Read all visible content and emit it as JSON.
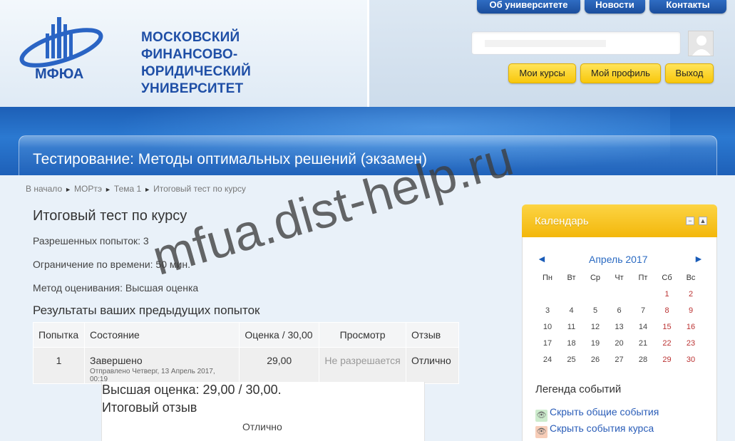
{
  "header": {
    "logo_text": "МФЮА",
    "university_name_lines": [
      "МОСКОВСКИЙ",
      "ФИНАНСОВО-",
      "ЮРИДИЧЕСКИЙ",
      "УНИВЕРСИТЕТ"
    ],
    "top_nav": [
      "Об университете",
      "Новости",
      "Контакты"
    ],
    "user_buttons": [
      "Мои курсы",
      "Мой профиль",
      "Выход"
    ]
  },
  "page_title": "Тестирование: Методы оптимальных решений (экзамен)",
  "breadcrumb": [
    "В начало",
    "МОРтэ",
    "Тема 1",
    "Итоговый тест по курсу"
  ],
  "quiz": {
    "title": "Итоговый тест по курсу",
    "attempts_allowed": "Разрешенных попыток: 3",
    "time_limit": "Ограничение по времени: 50 мин.",
    "grading_method": "Метод оценивания: Высшая оценка",
    "results_heading": "Результаты ваших предыдущих попыток",
    "table": {
      "headers": [
        "Попытка",
        "Состояние",
        "Оценка / 30,00",
        "Просмотр",
        "Отзыв"
      ],
      "rows": [
        {
          "attempt": "1",
          "state": "Завершено",
          "submitted": "Отправлено Четверг, 13 Апрель 2017, 00:19",
          "grade": "29,00",
          "review": "Не разрешается",
          "feedback": "Отлично"
        }
      ]
    },
    "best_grade": "Высшая оценка: 29,00 / 30,00.",
    "final_feedback_label": "Итоговый отзыв",
    "final_feedback_value": "Отлично"
  },
  "calendar": {
    "title": "Календарь",
    "month": "Апрель 2017",
    "prev": "◄",
    "next": "►",
    "weekdays": [
      "Пн",
      "Вт",
      "Ср",
      "Чт",
      "Пт",
      "Сб",
      "Вс"
    ],
    "weeks": [
      [
        "",
        "",
        "",
        "",
        "",
        "1",
        "2"
      ],
      [
        "3",
        "4",
        "5",
        "6",
        "7",
        "8",
        "9"
      ],
      [
        "10",
        "11",
        "12",
        "13",
        "14",
        "15",
        "16"
      ],
      [
        "17",
        "18",
        "19",
        "20",
        "21",
        "22",
        "23"
      ],
      [
        "24",
        "25",
        "26",
        "27",
        "28",
        "29",
        "30"
      ]
    ],
    "legend_title": "Легенда событий",
    "legend_items": [
      "Скрыть общие события",
      "Скрыть события курса"
    ]
  },
  "watermark": "mfua.dist-help.ru",
  "colors": {
    "brand_blue": "#1f4fa6",
    "band_blue": "#2b79d1",
    "yellow_button": "#f8c70b",
    "calendar_header": "#f3b70b",
    "link_blue": "#2a5db8"
  }
}
